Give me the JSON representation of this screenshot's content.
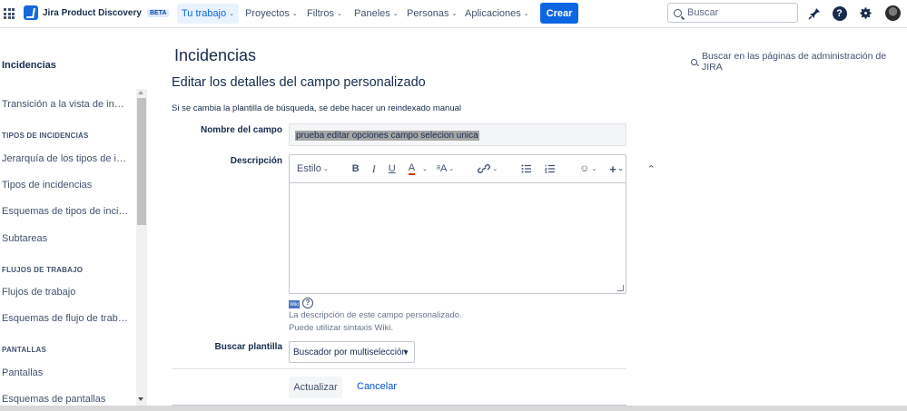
{
  "topnav": {
    "brand": "Jira Product Discovery",
    "beta": "BETA",
    "items": [
      {
        "label": "Tu trabajo"
      },
      {
        "label": "Proyectos"
      },
      {
        "label": "Filtros"
      },
      {
        "label": "Paneles"
      },
      {
        "label": "Personas"
      },
      {
        "label": "Aplicaciones"
      }
    ],
    "create_label": "Crear",
    "search_placeholder": "Buscar",
    "chevron": "⌄"
  },
  "sidebar": {
    "title": "Incidencias",
    "items": {
      "transicion": "Transición a la vista de incidencias",
      "jerarquia": "Jerarquía de los tipos de incidencia",
      "tipos": "Tipos de incidencias",
      "esquemas_tipos": "Esquemas de tipos de incidencia",
      "subtareas": "Subtareas",
      "flujos": "Flujos de trabajo",
      "esquemas_flujo": "Esquemas de flujo de trabajo",
      "pantallas": "Pantallas",
      "esquemas_pantallas": "Esquemas de pantallas"
    },
    "headings": {
      "tipos_incidencias": "TIPOS DE INCIDENCIAS",
      "flujos_trabajo": "FLUJOS DE TRABAJO",
      "pantallas": "PANTALLAS"
    }
  },
  "main": {
    "page_title": "Incidencias",
    "admin_search": "Buscar en las páginas de administración de JIRA",
    "section_title": "Editar los detalles del campo personalizado",
    "notice": "Si se cambia la plantilla de búsqueda, se debe hacer un reindexado manual",
    "field_name_label": "Nombre del campo",
    "field_name_value": "prueba editar opciones campo selecion unica",
    "description_label": "Descripción",
    "toolbar": {
      "style": "Estilo",
      "bold": "B",
      "italic": "I",
      "underline": "U",
      "color": "A",
      "text_size": "ᵃA",
      "link": "🔗",
      "bullet": "☰",
      "numbered": "☷",
      "emoji": "☺",
      "add": "+",
      "collapse": "⌃"
    },
    "wiki_badge": "Wiki",
    "help_q": "?",
    "desc_help_1": "La descripción de este campo personalizado.",
    "desc_help_2": "Puede utilizar sintaxis Wiki.",
    "search_template_label": "Buscar plantilla",
    "search_template_value": "Buscador por multiselección",
    "update_button": "Actualizar",
    "cancel_link": "Cancelar"
  },
  "colors": {
    "primary": "#0c66e4",
    "link": "#0052cc",
    "text": "#172b4d"
  }
}
